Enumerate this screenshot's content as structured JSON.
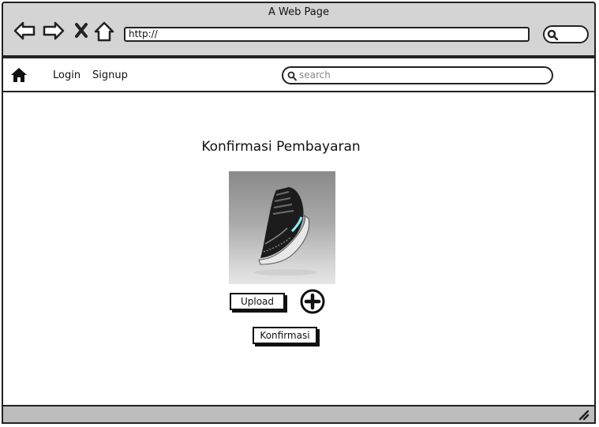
{
  "window": {
    "title": "A Web Page"
  },
  "address_bar": {
    "url": "http://"
  },
  "navbar": {
    "login_label": "Login",
    "signup_label": "Signup",
    "search_placeholder": "search"
  },
  "main": {
    "title": "Konfirmasi Pembayaran",
    "upload_label": "Upload",
    "confirm_label": "Konfirmasi",
    "image": "sneaker-photo"
  },
  "icons": {
    "back": "back-arrow-icon",
    "forward": "forward-arrow-icon",
    "stop": "close-icon",
    "home": "home-icon",
    "add": "plus-circle-icon",
    "search": "search-icon",
    "resize": "resize-grip-icon"
  }
}
